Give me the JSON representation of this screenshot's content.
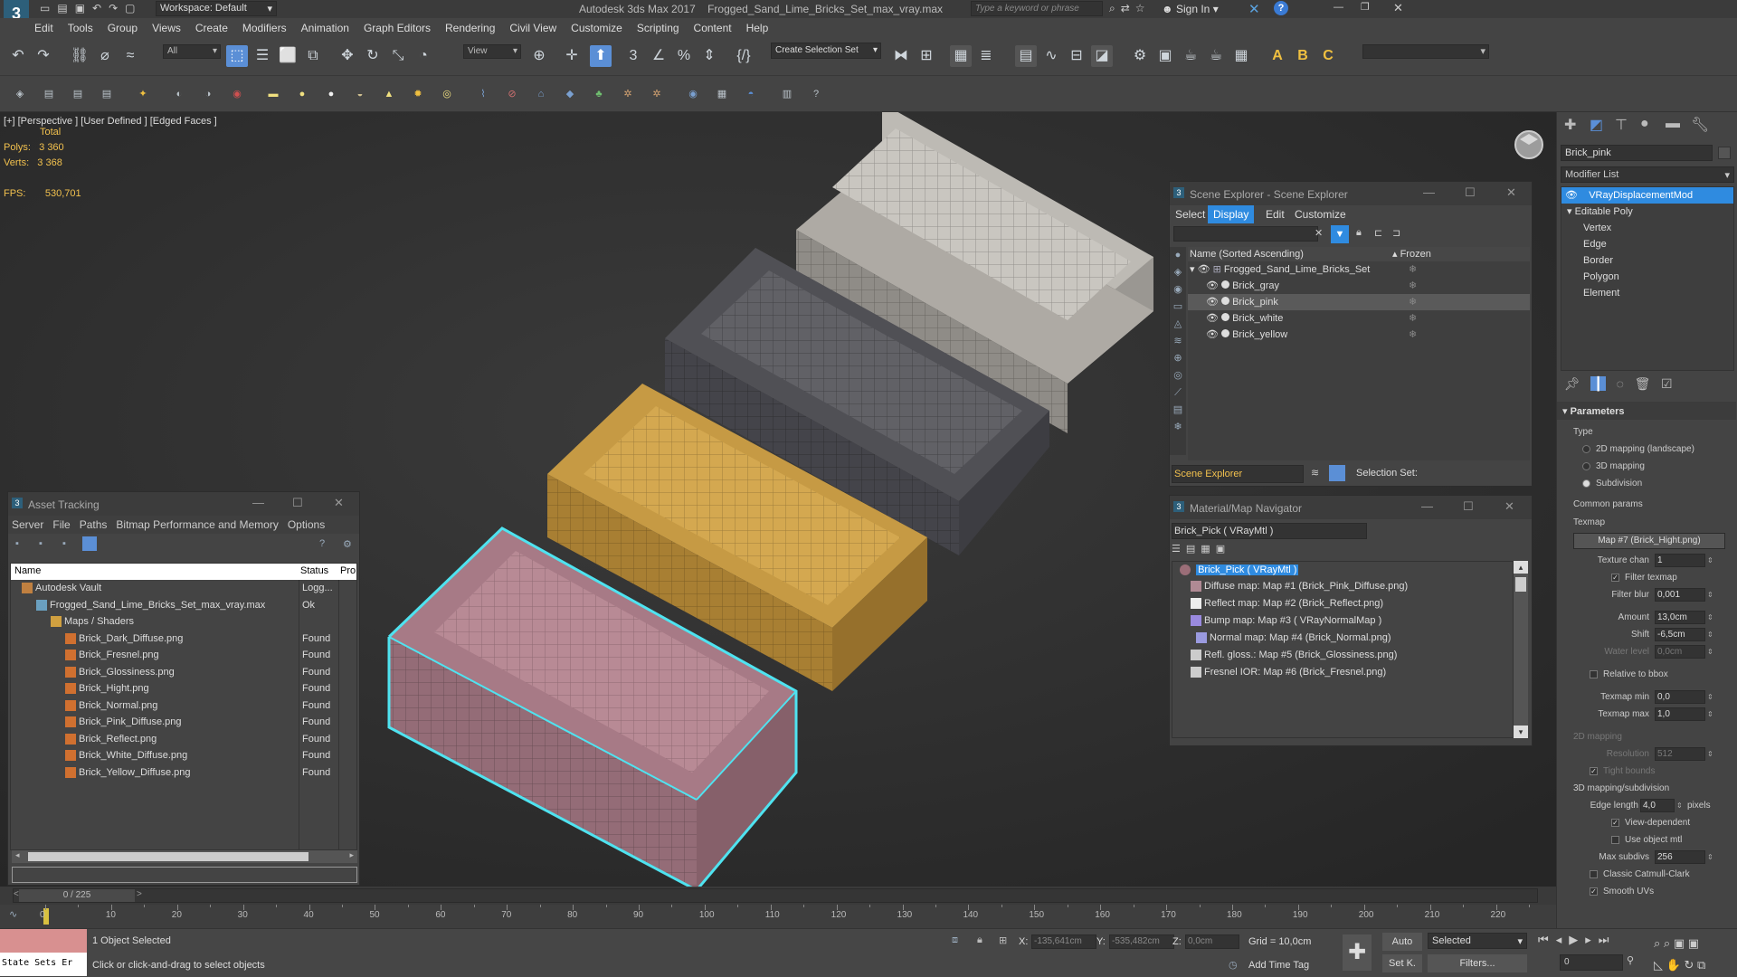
{
  "app": {
    "title": "Autodesk 3ds Max 2017",
    "filename": "Frogged_Sand_Lime_Bricks_Set_max_vray.max",
    "workspace": "Workspace: Default",
    "search_placeholder": "Type a keyword or phrase",
    "sign_in": "Sign In"
  },
  "menu": [
    "Edit",
    "Tools",
    "Group",
    "Views",
    "Create",
    "Modifiers",
    "Animation",
    "Graph Editors",
    "Rendering",
    "Civil View",
    "Customize",
    "Scripting",
    "Content",
    "Help"
  ],
  "toolbar": {
    "filter_value": "All",
    "view_value": "View",
    "selection_set": "Create Selection Set"
  },
  "viewport": {
    "label": "[+] [Perspective ] [User Defined ] [Edged Faces ]",
    "total": "Total",
    "polys_label": "Polys:",
    "polys_value": "3 360",
    "verts_label": "Verts:",
    "verts_value": "3 368",
    "fps_label": "FPS:",
    "fps_value": "530,701"
  },
  "scene_explorer": {
    "title": "Scene Explorer - Scene Explorer",
    "tabs": [
      "Select",
      "Display",
      "Edit",
      "Customize"
    ],
    "col_name": "Name (Sorted Ascending)",
    "col_frozen": "▴ Frozen",
    "root": "Frogged_Sand_Lime_Bricks_Set",
    "items": [
      "Brick_gray",
      "Brick_pink",
      "Brick_white",
      "Brick_yellow"
    ],
    "footer_label": "Scene Explorer",
    "selection_set_label": "Selection Set:"
  },
  "asset_tracking": {
    "title": "Asset Tracking",
    "menu": [
      "Server",
      "File",
      "Paths",
      "Bitmap Performance and Memory",
      "Options"
    ],
    "col_name": "Name",
    "col_status": "Status",
    "col_pro": "Pro",
    "rows": [
      {
        "name": "Autodesk Vault",
        "status": "Logg...",
        "indent": 0
      },
      {
        "name": "Frogged_Sand_Lime_Bricks_Set_max_vray.max",
        "status": "Ok",
        "indent": 1
      },
      {
        "name": "Maps / Shaders",
        "status": "",
        "indent": 2
      },
      {
        "name": "Brick_Dark_Diffuse.png",
        "status": "Found",
        "indent": 3
      },
      {
        "name": "Brick_Fresnel.png",
        "status": "Found",
        "indent": 3
      },
      {
        "name": "Brick_Glossiness.png",
        "status": "Found",
        "indent": 3
      },
      {
        "name": "Brick_Hight.png",
        "status": "Found",
        "indent": 3
      },
      {
        "name": "Brick_Normal.png",
        "status": "Found",
        "indent": 3
      },
      {
        "name": "Brick_Pink_Diffuse.png",
        "status": "Found",
        "indent": 3
      },
      {
        "name": "Brick_Reflect.png",
        "status": "Found",
        "indent": 3
      },
      {
        "name": "Brick_White_Diffuse.png",
        "status": "Found",
        "indent": 3
      },
      {
        "name": "Brick_Yellow_Diffuse.png",
        "status": "Found",
        "indent": 3
      }
    ]
  },
  "material_nav": {
    "title": "Material/Map Navigator",
    "current": "Brick_Pick  ( VRayMtl )",
    "root": "Brick_Pick  ( VRayMtl )",
    "items": [
      "Diffuse map: Map #1 (Brick_Pink_Diffuse.png)",
      "Reflect map: Map #2 (Brick_Reflect.png)",
      "Bump map: Map #3  ( VRayNormalMap )",
      "Normal map: Map #4 (Brick_Normal.png)",
      "Refl. gloss.: Map #5 (Brick_Glossiness.png)",
      "Fresnel IOR: Map #6 (Brick_Fresnel.png)"
    ]
  },
  "command_panel": {
    "object_name": "Brick_pink",
    "modifier_list": "Modifier List",
    "stack": [
      "VRayDisplacementMod",
      "Editable Poly",
      "Vertex",
      "Edge",
      "Border",
      "Polygon",
      "Element"
    ],
    "parameters_title": "Parameters",
    "type_label": "Type",
    "type_options": [
      "2D mapping (landscape)",
      "3D mapping",
      "Subdivision"
    ],
    "common_params": "Common params",
    "texmap_label": "Texmap",
    "texmap_value": "Map #7 (Brick_Hight.png)",
    "texture_chan_label": "Texture chan",
    "texture_chan_value": "1",
    "filter_texmap": "Filter texmap",
    "filter_blur_label": "Filter blur",
    "filter_blur_value": "0,001",
    "amount_label": "Amount",
    "amount_value": "13,0cm",
    "shift_label": "Shift",
    "shift_value": "-6,5cm",
    "water_level_label": "Water level",
    "water_level_value": "0,0cm",
    "relative_bbox": "Relative to bbox",
    "texmap_min_label": "Texmap min",
    "texmap_min_value": "0,0",
    "texmap_max_label": "Texmap max",
    "texmap_max_value": "1,0",
    "mapping_2d": "2D mapping",
    "resolution_label": "Resolution",
    "resolution_value": "512",
    "tight_bounds": "Tight bounds",
    "mapping_3d": "3D mapping/subdivision",
    "edge_length_label": "Edge length",
    "edge_length_value": "4,0",
    "pixels": "pixels",
    "view_dependent": "View-dependent",
    "use_object_mtl": "Use object mtl",
    "max_subdivs_label": "Max subdivs",
    "max_subdivs_value": "256",
    "classic_cc": "Classic Catmull-Clark",
    "smooth_uvs": "Smooth UVs"
  },
  "timeline": {
    "frame": "0 / 225",
    "ticks": [
      "0",
      "10",
      "20",
      "30",
      "40",
      "50",
      "60",
      "70",
      "80",
      "90",
      "100",
      "110",
      "120",
      "130",
      "140",
      "150",
      "160",
      "170",
      "180",
      "190",
      "200",
      "210",
      "220"
    ]
  },
  "status": {
    "selected": "1 Object Selected",
    "hint": "Click or click-and-drag to select objects",
    "x_label": "X:",
    "x_value": "-135,641cm",
    "y_label": "Y:",
    "y_value": "-535,482cm",
    "z_label": "Z:",
    "z_value": "0,0cm",
    "grid": "Grid = 10,0cm",
    "auto": "Auto",
    "set_k": "Set K.",
    "selected_dd": "Selected",
    "filters": "Filters...",
    "add_time_tag": "Add Time Tag",
    "state_sets": "State Sets Er",
    "frame_field": "0"
  },
  "colors": {
    "accent": "#2f8be0",
    "viewport_bg": "#2b2b2b",
    "stats": "#f2c14e",
    "selection_cyan": "#4fe3f0",
    "found_text": "#dddddd"
  }
}
